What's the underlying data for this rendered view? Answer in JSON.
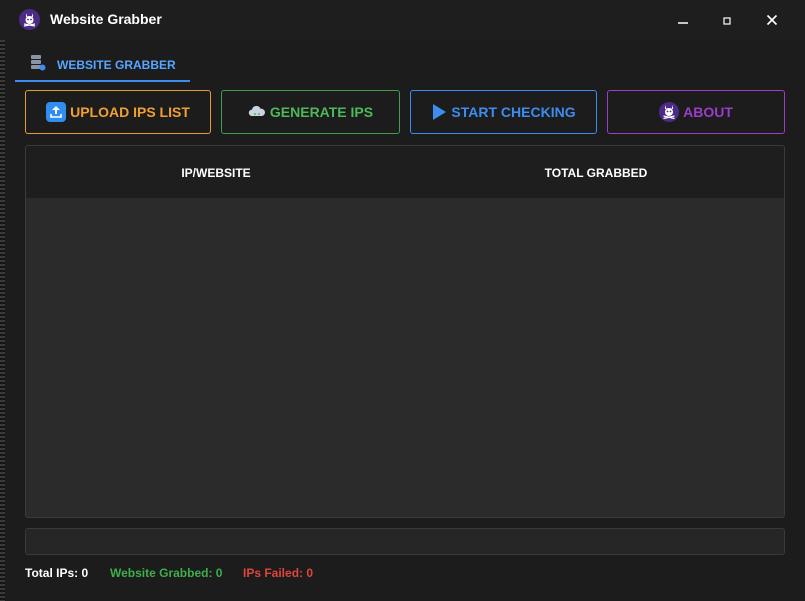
{
  "window": {
    "title": "Website Grabber",
    "app_icon": "skull-bunny-icon",
    "controls": [
      "minimize",
      "maximize",
      "close"
    ]
  },
  "tabs": [
    {
      "label": "WEBSITE GRABBER",
      "icon": "server-icon",
      "active": true
    }
  ],
  "toolbar": {
    "upload": {
      "label": "UPLOAD IPS LIST",
      "icon": "upload-icon",
      "color": "#f0a030"
    },
    "generate": {
      "label": "GENERATE IPS",
      "icon": "cloud-icon",
      "color": "#4cb85a"
    },
    "start": {
      "label": "START CHECKING",
      "icon": "play-icon",
      "color": "#3d8cf0"
    },
    "about": {
      "label": "ABOUT",
      "icon": "skull-bunny-icon",
      "color": "#9b3dc8"
    }
  },
  "table": {
    "columns": [
      "IP/WEBSITE",
      "TOTAL GRABBED"
    ],
    "rows": []
  },
  "progress": {
    "value": 0
  },
  "status": {
    "total_ips": "Total IPs: 0",
    "website_grabbed": "Website Grabbed: 0",
    "ips_failed": "IPs Failed: 0"
  },
  "colors": {
    "background": "#1c1c1c",
    "accent_blue": "#3d8cf0",
    "orange": "#f0a030",
    "green": "#4cb85a",
    "purple": "#9b3dc8",
    "red": "#e0453a"
  }
}
